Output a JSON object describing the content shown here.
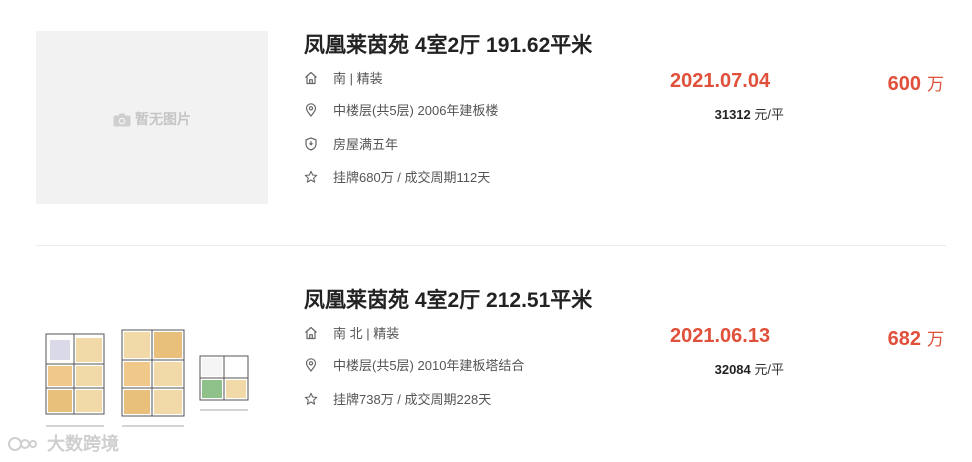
{
  "listings": [
    {
      "title": "凤凰莱茵苑 4室2厅 191.62平米",
      "image_placeholder": "暂无图片",
      "orientation_decoration": "南 | 精装",
      "floor_info": "中楼层(共5层) 2006年建板楼",
      "tag": "房屋满五年",
      "listing_info": "挂牌680万 / 成交周期112天",
      "deal_date": "2021.07.04",
      "unit_price_value": "31312",
      "unit_price_suffix": " 元/平",
      "total_price": "600",
      "total_unit": "万"
    },
    {
      "title": "凤凰莱茵苑 4室2厅 212.51平米",
      "orientation_decoration": "南 北 | 精装",
      "floor_info": "中楼层(共5层) 2010年建板塔结合",
      "listing_info": "挂牌738万 / 成交周期228天",
      "deal_date": "2021.06.13",
      "unit_price_value": "32084",
      "unit_price_suffix": " 元/平",
      "total_price": "682",
      "total_unit": "万"
    }
  ],
  "watermark": "大数跨境",
  "colors": {
    "accent_red": "#e0503a",
    "title": "#222222",
    "text_gray": "#555555",
    "placeholder_bg": "#f2f2f2"
  },
  "icons": {
    "orientation": "house-icon",
    "floor": "location-pin-icon",
    "tag": "shield-icon",
    "listing": "star-icon",
    "placeholder": "camera-icon"
  }
}
